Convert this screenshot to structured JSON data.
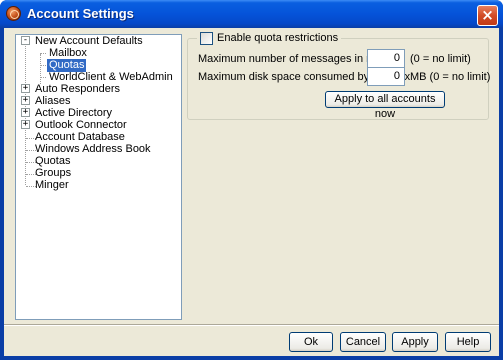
{
  "window": {
    "title": "Account Settings",
    "close_glyph": "×"
  },
  "tree": {
    "items": [
      {
        "label": "New Account Defaults",
        "expander": "-"
      },
      {
        "label": "Mailbox"
      },
      {
        "label": "Quotas",
        "selected": true
      },
      {
        "label": "WorldClient & WebAdmin"
      },
      {
        "label": "Auto Responders",
        "expander": "+"
      },
      {
        "label": "Aliases",
        "expander": "+"
      },
      {
        "label": "Active Directory",
        "expander": "+"
      },
      {
        "label": "Outlook Connector",
        "expander": "+"
      },
      {
        "label": "Account Database"
      },
      {
        "label": "Windows Address Book"
      },
      {
        "label": "Quotas"
      },
      {
        "label": "Groups"
      },
      {
        "label": "Minger"
      }
    ]
  },
  "quota": {
    "enable_label": "Enable quota restrictions",
    "enable_checked": false,
    "max_messages_label": "Maximum number of messages in mailbox",
    "max_messages_value": "0",
    "max_messages_hint": "(0 = no limit)",
    "max_disk_label": "Maximum disk space consumed by mailbox",
    "max_disk_value": "0",
    "max_disk_hint": "MB (0 = no limit)",
    "apply_all_label": "Apply to all accounts now"
  },
  "buttons": {
    "ok": "Ok",
    "cancel": "Cancel",
    "apply": "Apply",
    "help": "Help"
  },
  "colors": {
    "selection": "#316ac5",
    "titlebar": "#0553d9",
    "dialog_bg": "#ece9d8"
  },
  "icons": {
    "app": "daemon-icon",
    "close": "close-icon",
    "expand": "plus-expander-icon",
    "collapse": "minus-expander-icon"
  }
}
